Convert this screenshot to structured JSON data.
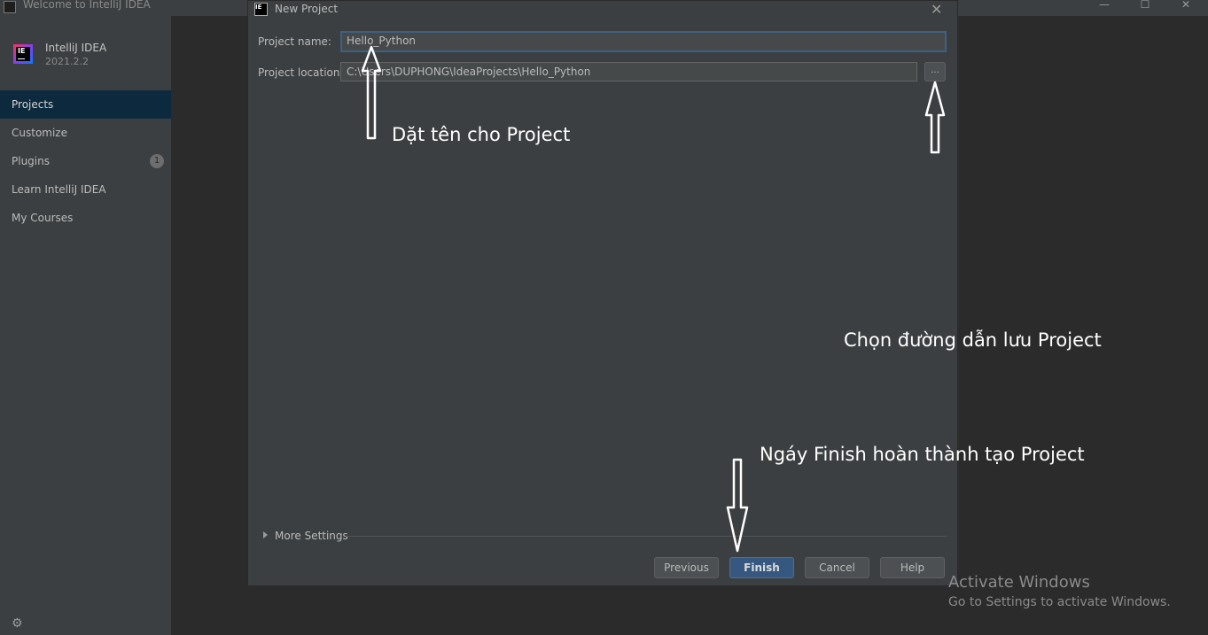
{
  "window": {
    "title": "Welcome to IntelliJ IDEA",
    "minimize": "—",
    "maximize": "☐",
    "close": "✕"
  },
  "sidebar": {
    "product_name": "IntelliJ IDEA",
    "product_version": "2021.2.2",
    "logo_text": "IE",
    "items": [
      {
        "label": "Projects",
        "active": true
      },
      {
        "label": "Customize"
      },
      {
        "label": "Plugins",
        "badge": "1"
      },
      {
        "label": "Learn IntelliJ IDEA"
      },
      {
        "label": "My Courses"
      }
    ],
    "settings_icon": "⚙"
  },
  "dialog": {
    "title": "New Project",
    "icon_text": "IE",
    "close": "✕",
    "project_name_label": "Project name:",
    "project_name_value": "Hello_Python",
    "project_location_label": "Project location:",
    "project_location_value": "C:\\Users\\DUPHONG\\IdeaProjects\\Hello_Python",
    "browse_label": "...",
    "more_settings": "More Settings",
    "buttons": {
      "previous": "Previous",
      "finish": "Finish",
      "cancel": "Cancel",
      "help": "Help"
    }
  },
  "annotations": {
    "name": "Dặt tên cho Project",
    "location": "Chọn đường dẫn lưu Project",
    "finish": "Ngáy Finish hoàn thành tạo Project"
  },
  "watermark": {
    "line1": "Activate Windows",
    "line2": "Go to Settings to activate Windows."
  },
  "colors": {
    "background": "#2b2b2b",
    "panel": "#3c3f41",
    "active_nav": "#0d293e",
    "primary_button": "#365880",
    "focus_border": "#3d6185"
  }
}
